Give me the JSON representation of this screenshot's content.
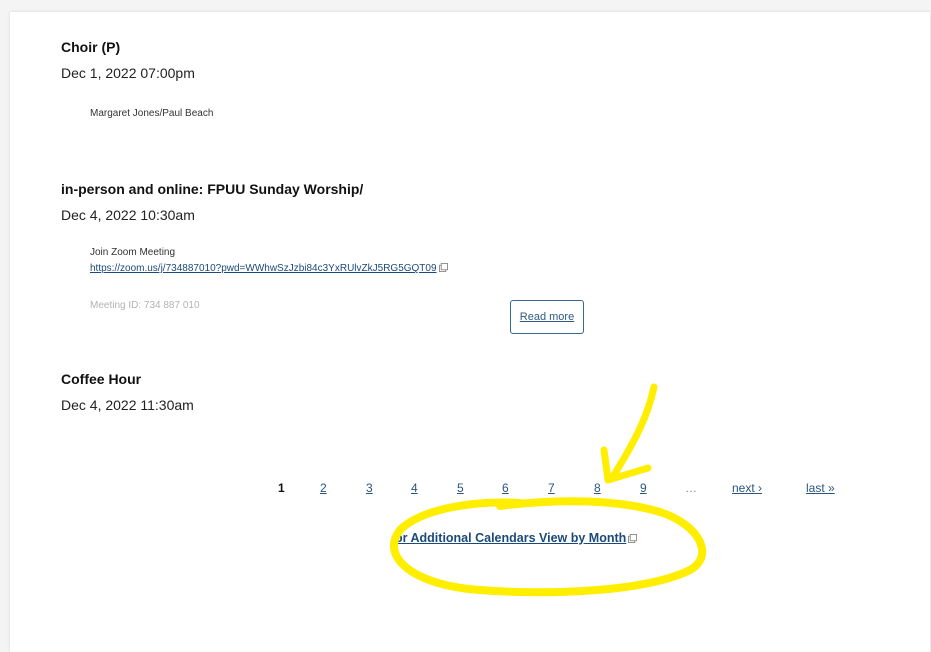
{
  "events": [
    {
      "title": "Choir (P)",
      "date": "Dec 1, 2022 07:00pm",
      "body": "Margaret Jones/Paul Beach"
    },
    {
      "title": "in-person and online: FPUU Sunday Worship/",
      "date": "Dec 4, 2022 10:30am",
      "body_line1": "Join Zoom Meeting",
      "zoom_link": "https://zoom.us/j/734887010?pwd=WWhwSzJzbi84c3YxRUlvZkJ5RG5GQT09",
      "meeting_id": "Meeting ID: 734 887 010",
      "read_more": "Read more"
    },
    {
      "title": "Coffee Hour",
      "date": "Dec 4, 2022 11:30am"
    }
  ],
  "pager": {
    "current": "1",
    "pages": [
      "2",
      "3",
      "4",
      "5",
      "6",
      "7",
      "8",
      "9"
    ],
    "ellipsis": "…",
    "next": "next ›",
    "last": "last »"
  },
  "additional_link": "or Additional Calendars View by Month",
  "icons": {
    "external": "external-link-icon"
  },
  "colors": {
    "link": "#1b4a7a",
    "annotation": "#ffee00"
  }
}
